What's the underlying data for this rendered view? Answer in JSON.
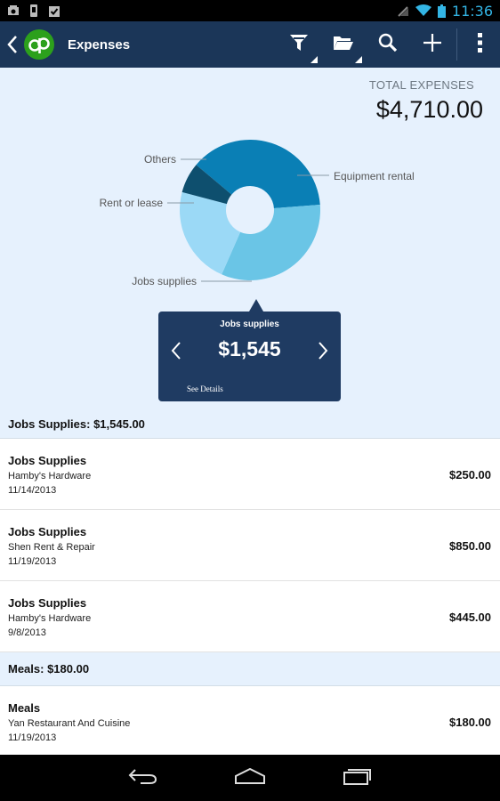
{
  "status_bar": {
    "time": "11:36"
  },
  "action_bar": {
    "title": "Expenses"
  },
  "summary": {
    "total_label": "TOTAL EXPENSES",
    "total_value": "$4,710.00"
  },
  "chart_data": {
    "type": "pie",
    "labels": [
      "Equipment rental",
      "Jobs supplies",
      "Rent or lease",
      "Others"
    ],
    "values": [
      1775,
      1545,
      1060,
      330
    ],
    "colors": [
      "#0a7fb5",
      "#6ac5e6",
      "#9bd9f6",
      "#0e4f6e"
    ],
    "title": "",
    "ylabel": ""
  },
  "popover": {
    "title": "Jobs supplies",
    "value": "$1,545",
    "details_label": "See Details"
  },
  "groups": [
    {
      "header": "Jobs Supplies: $1,545.00",
      "items": [
        {
          "title": "Jobs Supplies",
          "vendor": "Hamby's Hardware",
          "date": "11/14/2013",
          "amount": "$250.00"
        },
        {
          "title": "Jobs Supplies",
          "vendor": "Shen Rent & Repair",
          "date": "11/19/2013",
          "amount": "$850.00"
        },
        {
          "title": "Jobs Supplies",
          "vendor": "Hamby's Hardware",
          "date": "9/8/2013",
          "amount": "$445.00"
        }
      ]
    },
    {
      "header": "Meals: $180.00",
      "items": [
        {
          "title": "Meals",
          "vendor": "Yan Restaurant And Cuisine",
          "date": "11/19/2013",
          "amount": "$180.00"
        }
      ]
    }
  ]
}
